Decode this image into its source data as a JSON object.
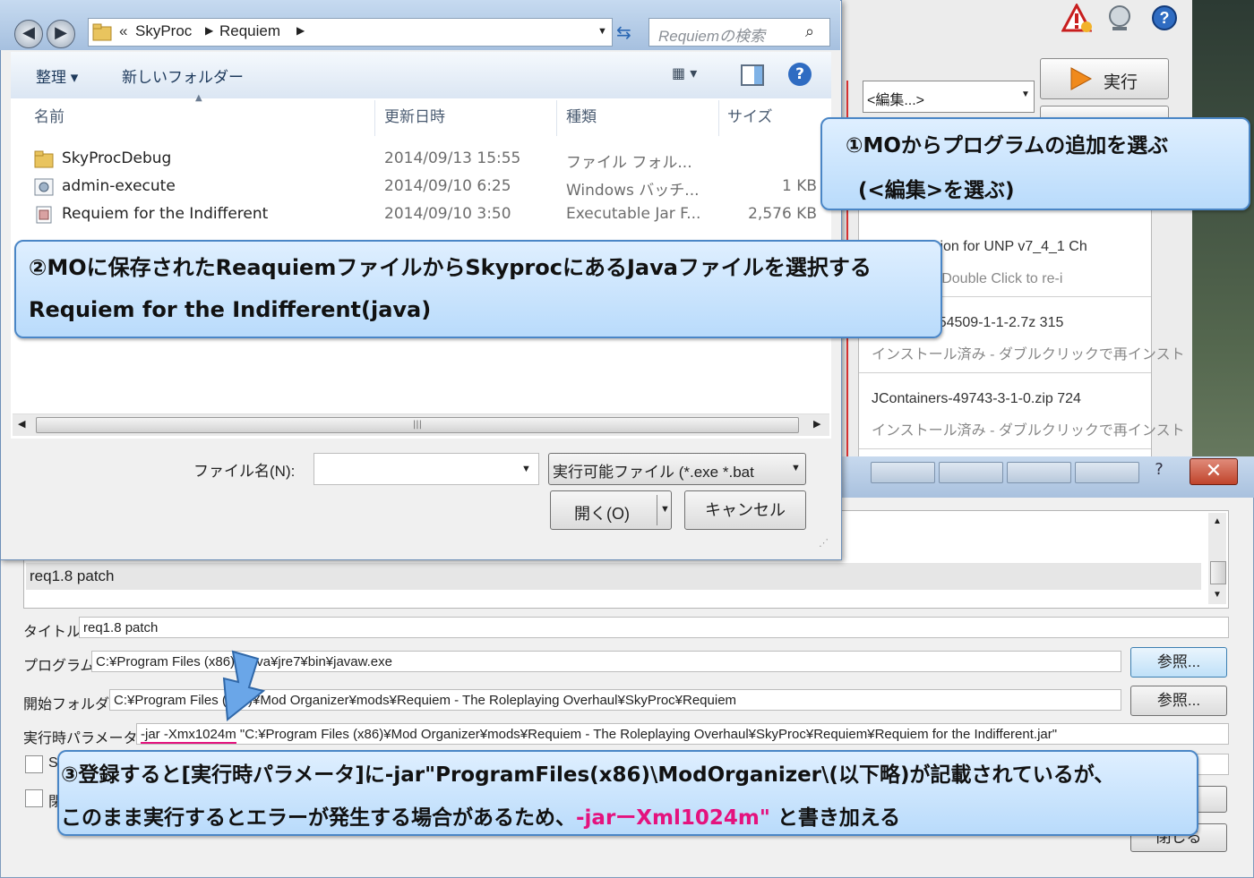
{
  "mo_main": {
    "edit_combo": "<編集...>",
    "run_label": "実行",
    "list_items": [
      {
        "line1": "n Complexion for UNP v7_4_1 Ch",
        "line2": "ール済み - Double Click to re-i"
      },
      {
        "line1": "ces_1.1.2-54509-1-1-2.7z  315",
        "line2": "インストール済み - ダブルクリックで再インスト"
      },
      {
        "line1": "JContainers-49743-3-1-0.zip   724",
        "line2": "インストール済み - ダブルクリックで再インスト"
      }
    ]
  },
  "file_dialog": {
    "breadcrumb": [
      "«",
      "SkyProc",
      "Requiem"
    ],
    "search_placeholder": "Requiemの検索",
    "toolbar": {
      "organize": "整理 ▾",
      "new_folder": "新しいフォルダー"
    },
    "columns": {
      "name": "名前",
      "date": "更新日時",
      "type": "種類",
      "size": "サイズ"
    },
    "files": [
      {
        "name": "SkyProcDebug",
        "date": "2014/09/13 15:55",
        "type": "ファイル フォル...",
        "size": ""
      },
      {
        "name": "admin-execute",
        "date": "2014/09/10 6:25",
        "type": "Windows バッチ...",
        "size": "1 KB"
      },
      {
        "name": "Requiem for the Indifferent",
        "date": "2014/09/10 3:50",
        "type": "Executable Jar F...",
        "size": "2,576 KB"
      }
    ],
    "filename_label": "ファイル名(N):",
    "filename_value": "",
    "filetype_value": "実行可能ファイル (*.exe *.bat",
    "open_button": "開く(O)",
    "cancel_button": "キャンセル"
  },
  "edit_dialog": {
    "list_selected": "req1.8 patch",
    "title_label": "タイトル",
    "title_value": "req1.8 patch",
    "program_label": "プログラム",
    "program_value": "C:¥Program Files (x86)¥Java¥jre7¥bin¥javaw.exe",
    "startdir_label": "開始フォルダ",
    "startdir_value": "C:¥Program Files (x86)¥Mod Organizer¥mods¥Requiem - The Roleplaying Overhaul¥SkyProc¥Requiem",
    "params_label": "実行時パラメータ",
    "params_prefix": "-jar -Xmx1024m",
    "params_rest": " \"C:¥Program Files (x86)¥Mod Organizer¥mods¥Requiem - The Roleplaying Overhaul¥SkyProc¥Requiem¥Requiem for the Indifferent.jar\"",
    "browse_label": "参照...",
    "close_label": "閉じる",
    "check1_label": "S",
    "check2_label": "閉"
  },
  "callouts": {
    "c1_line1": "①MOからプログラムの追加を選ぶ",
    "c1_line2": "(<編集>を選ぶ)",
    "c2_line1": "②MOに保存されたReaquiemファイルからSkyprocにあるJavaファイルを選択する",
    "c2_line2": "Requiem for the Indifferent(java)",
    "c3_line1": "③登録すると[実行時パラメータ]に-jar\"ProgramFiles(x86)\\ModOrganizer\\(以下略)が記載されているが、",
    "c3_line2_a": "このまま実行するとエラーが発生する場合があるため、",
    "c3_line2_pink": "-jarーXml1024m\"",
    "c3_line2_b": " と書き加える"
  },
  "colors": {
    "callout_border": "#4a86c6",
    "highlight_pink": "#e4127e",
    "arrow_blue": "#6aa6e8"
  }
}
